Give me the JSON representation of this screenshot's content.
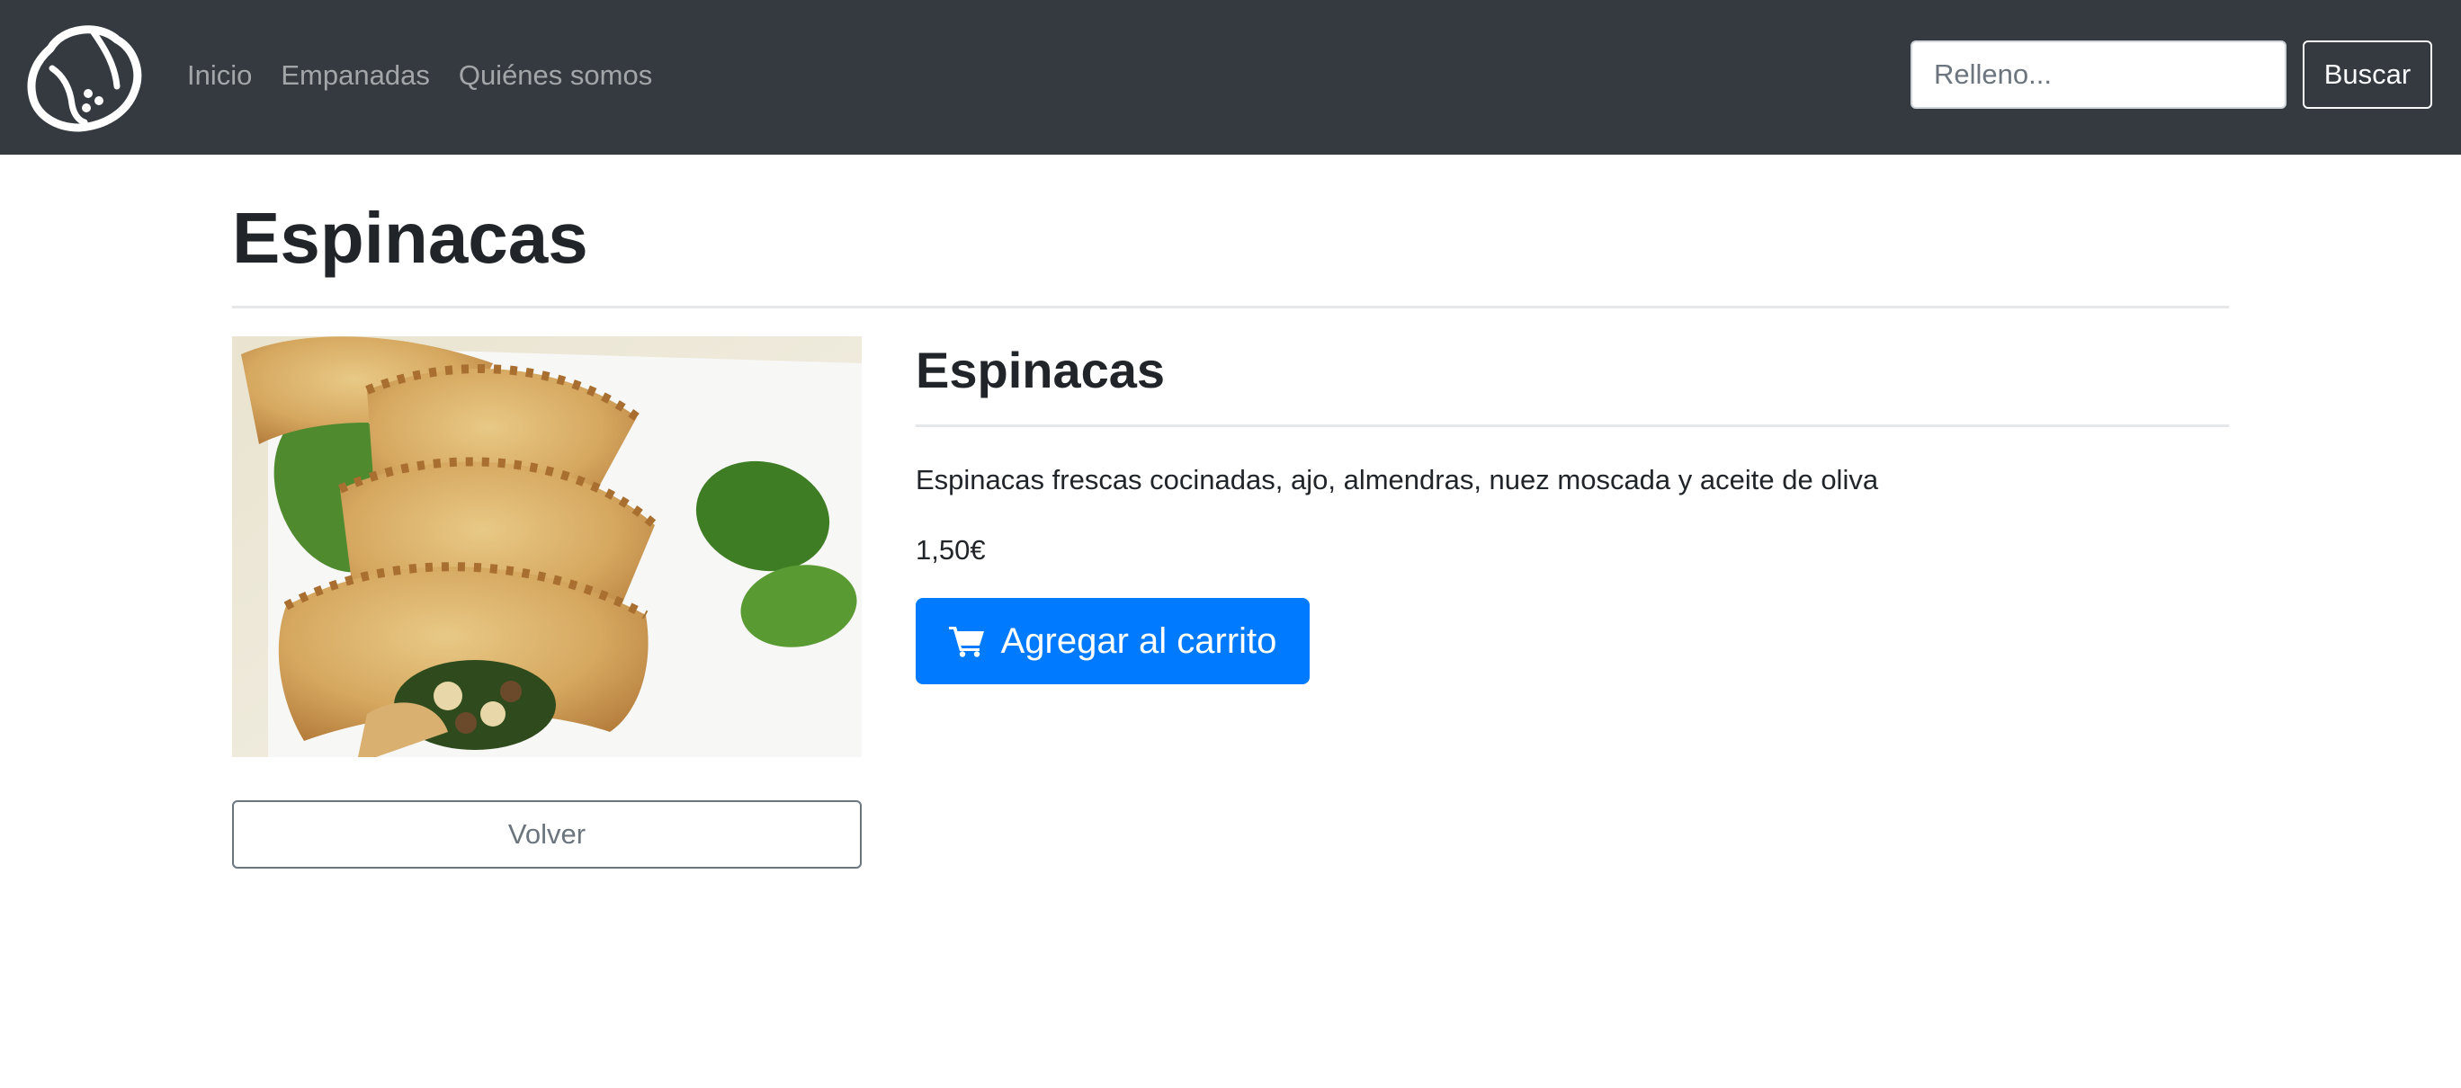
{
  "brand": {
    "icon": "empanada-logo-icon"
  },
  "nav": {
    "items": [
      {
        "label": "Inicio"
      },
      {
        "label": "Empanadas"
      },
      {
        "label": "Quiénes somos"
      }
    ]
  },
  "search": {
    "placeholder": "Relleno...",
    "value": "",
    "button_label": "Buscar"
  },
  "page": {
    "title": "Espinacas"
  },
  "product": {
    "name": "Espinacas",
    "description": "Espinacas frescas cocinadas, ajo, almendras, nuez moscada y aceite de oliva",
    "price": "1,50€",
    "add_to_cart_label": "Agregar al carrito",
    "add_to_cart_icon": "shopping-cart-icon",
    "back_label": "Volver"
  },
  "colors": {
    "navbar_bg": "#343a40",
    "nav_link": "rgba(255,255,255,0.55)",
    "primary": "#007bff",
    "secondary": "#6c757d"
  }
}
